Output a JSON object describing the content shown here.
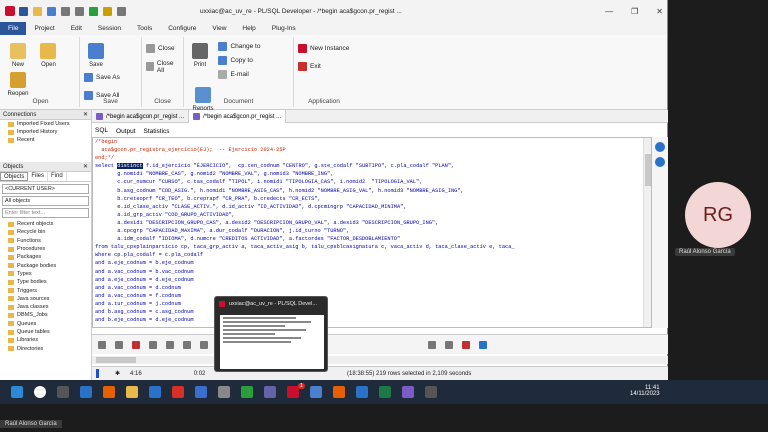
{
  "titlebar": {
    "title": "uxxiac@ac_uv_re - PL/SQL Developer - /*begin aca$gcon.pr_regist ...",
    "minimize": "—",
    "restore": "❐",
    "close": "✕"
  },
  "menu": [
    "File",
    "Project",
    "Edit",
    "Session",
    "Tools",
    "Configure",
    "View",
    "Help",
    "Plug-Ins"
  ],
  "ribbon": {
    "open_group": {
      "label": "Open",
      "buttons": [
        "New",
        "Open",
        "Reopen"
      ]
    },
    "save_group": {
      "label": "Save",
      "buttons": [
        "Save"
      ],
      "small": [
        "Save As",
        "Save All"
      ]
    },
    "close_group": {
      "label": "Close",
      "small": [
        "Close",
        "Close All"
      ]
    },
    "document_group": {
      "label": "Document",
      "buttons": [
        "Print"
      ],
      "small": [
        "Change to",
        "Copy to",
        "E-mail"
      ],
      "reports": "Reports"
    },
    "application_group": {
      "label": "Application",
      "small": [
        "New Instance",
        "Exit"
      ]
    }
  },
  "connections": {
    "header": "Connections",
    "items": [
      "Imported Fixed Users",
      "Imported History",
      "Recent"
    ]
  },
  "objects": {
    "header": "Objects",
    "tabs": [
      "Objects",
      "Files",
      "Find"
    ],
    "user_combo": "<CURRENT USER>",
    "all_objects": "All objects",
    "filter_placeholder": "Enter filter text...",
    "items": [
      "Recent objects",
      "Recycle bin",
      "Functions",
      "Procedures",
      "Packages",
      "Package bodies",
      "Types",
      "Type bodies",
      "Triggers",
      "Java sources",
      "Java classes",
      "DBMS_Jobs",
      "Queues",
      "Queue tables",
      "Libraries",
      "Directories"
    ]
  },
  "doctabs": [
    "/*begin aca$gcon.pr_regist ...",
    "/*begin aca$gcon.pr_regist ..."
  ],
  "sqltabs": [
    "SQL",
    "Output",
    "Statistics"
  ],
  "code": [
    "/*begin",
    "  aca$gcon.pr_registra_ejercicio(EJ);  -- Ejercicio 2024-25P",
    "end;*/",
    "select distinct f.id_ejercicio \"EJERCICIO\",  cp.cen_codnum \"CENTRO\", g.ste_codalf \"SUBTIPO\", c.pla_codalf \"PLAN\",",
    "       g.nomid1 \"NOMBRE_CAS\", g.nomid2 \"NOMBRE_VAL\", g.nomid3 \"NOMBRE_ING\",",
    "       c.cur_numcur \"CURSO\", c.tas_codalf \"TIPOL\", i.nomid1 \"TIPOLOGIA_CAS\", i.nomid2  \"TIPOLOGIA_VAL\",",
    "       b.asg_codnum \"COD_ASIG.\", h.nomid1 \"NOMBRE_ASIG_CAS\", h.nomid2 \"NOMBRE_ASIG_VAL\", h.nomid3 \"NOMBRE_ASIG_ING\",",
    "       b.creteoprf \"CR_TEO\", b.creprapf \"CR_PRA\", b.credects \"CR_ECTS\",",
    "       e.id_clase_activ \"CLASE_ACTIV.\", d.id_activ \"ID_ACTIVIDAD\", d.cpcmingrp \"CAPACIDAD_MINIMA\",",
    "       a.id_grp_activ \"COD_GRUPO_ACTIVIDAD\",",
    "       a.desid1 \"DESCRIPCION_GRUPO_CAS\", a.desid2 \"DESCRIPCION_GRUPO_VAL\", a.desid3 \"DESCRIPCION_GRUPO_ING\",",
    "       a.cpcgrp \"CAPACIDAD_MAXIMA\", a.dur_codalf \"DURACION\", j.id_turno \"TURNO\",",
    "       a.idm_codalf \"IDIOMA\", d.numcre \"CREDITOS ACTIVIDAD\", a.factordes \"FACTOR_DESDOBLAMIENTO\"",
    "from talu_cpsplainparticio cp, taca_grp_activ a, taca_activ_asig b, talu_cpsblcasignatura c, vaca_activ d, taca_clase_activ e, taca_",
    "where cp.pla_codalf = c.pla_codalf",
    "and a.eje_codnum = b.eje_codnum",
    "and a.vac_codnum = b.vac_codnum",
    "and a.eje_codnum = d.eje_codnum",
    "and a.vac_codnum = d.codnum",
    "and a.vac_codnum = f.codnum",
    "and a.tur_codnum = j.codnum",
    "and b.asg_codnum = c.asg_codnum",
    "and b.eje_codnum = d.eje_codnum"
  ],
  "status": {
    "position": "4:16",
    "time": "0:02",
    "rows": "219 rows selected in 2,109 seconds",
    "partial": "(18:38:55)"
  },
  "popup": {
    "title": "uxxiac@ac_uv_re - PL/SQL Devel..."
  },
  "meet": {
    "initials": "RG",
    "name": "Raúl Alonso García"
  },
  "taskbar": {
    "time": "11:41",
    "date": "14/11/2023",
    "user": "Raúl Alonso García",
    "badge": "1"
  },
  "colors": {
    "accent": "#2b579a",
    "highlight": "#0a246a",
    "comment": "#cc2200",
    "string": "#0000aa"
  }
}
